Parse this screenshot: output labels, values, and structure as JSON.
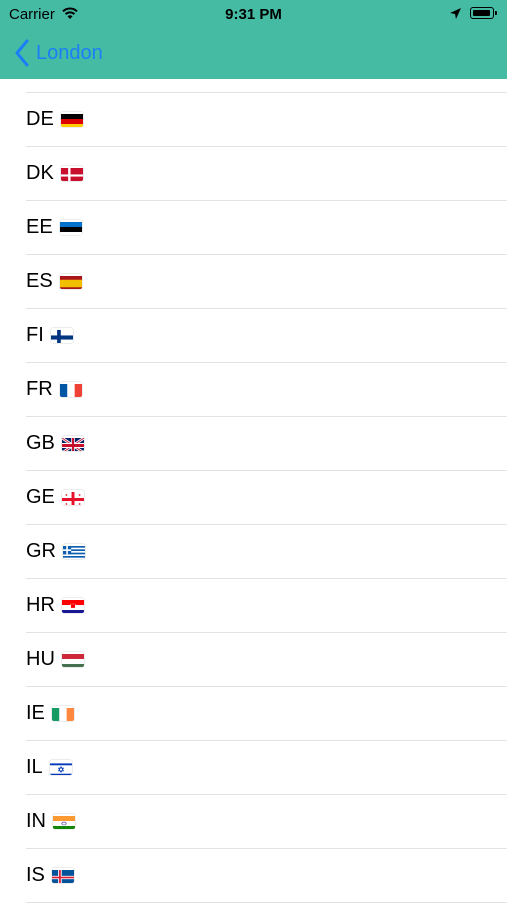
{
  "status_bar": {
    "carrier": "Carrier",
    "time": "9:31 PM"
  },
  "nav": {
    "back_label": "London"
  },
  "colors": {
    "header": "#46bba4",
    "tint": "#1a7ff6"
  },
  "countries": [
    {
      "code": "DE",
      "flag": "germany-flag"
    },
    {
      "code": "DK",
      "flag": "denmark-flag"
    },
    {
      "code": "EE",
      "flag": "estonia-flag"
    },
    {
      "code": "ES",
      "flag": "spain-flag"
    },
    {
      "code": "FI",
      "flag": "finland-flag"
    },
    {
      "code": "FR",
      "flag": "france-flag"
    },
    {
      "code": "GB",
      "flag": "uk-flag"
    },
    {
      "code": "GE",
      "flag": "georgia-flag"
    },
    {
      "code": "GR",
      "flag": "greece-flag"
    },
    {
      "code": "HR",
      "flag": "croatia-flag"
    },
    {
      "code": "HU",
      "flag": "hungary-flag"
    },
    {
      "code": "IE",
      "flag": "ireland-flag"
    },
    {
      "code": "IL",
      "flag": "israel-flag"
    },
    {
      "code": "IN",
      "flag": "india-flag"
    },
    {
      "code": "IS",
      "flag": "iceland-flag"
    }
  ]
}
